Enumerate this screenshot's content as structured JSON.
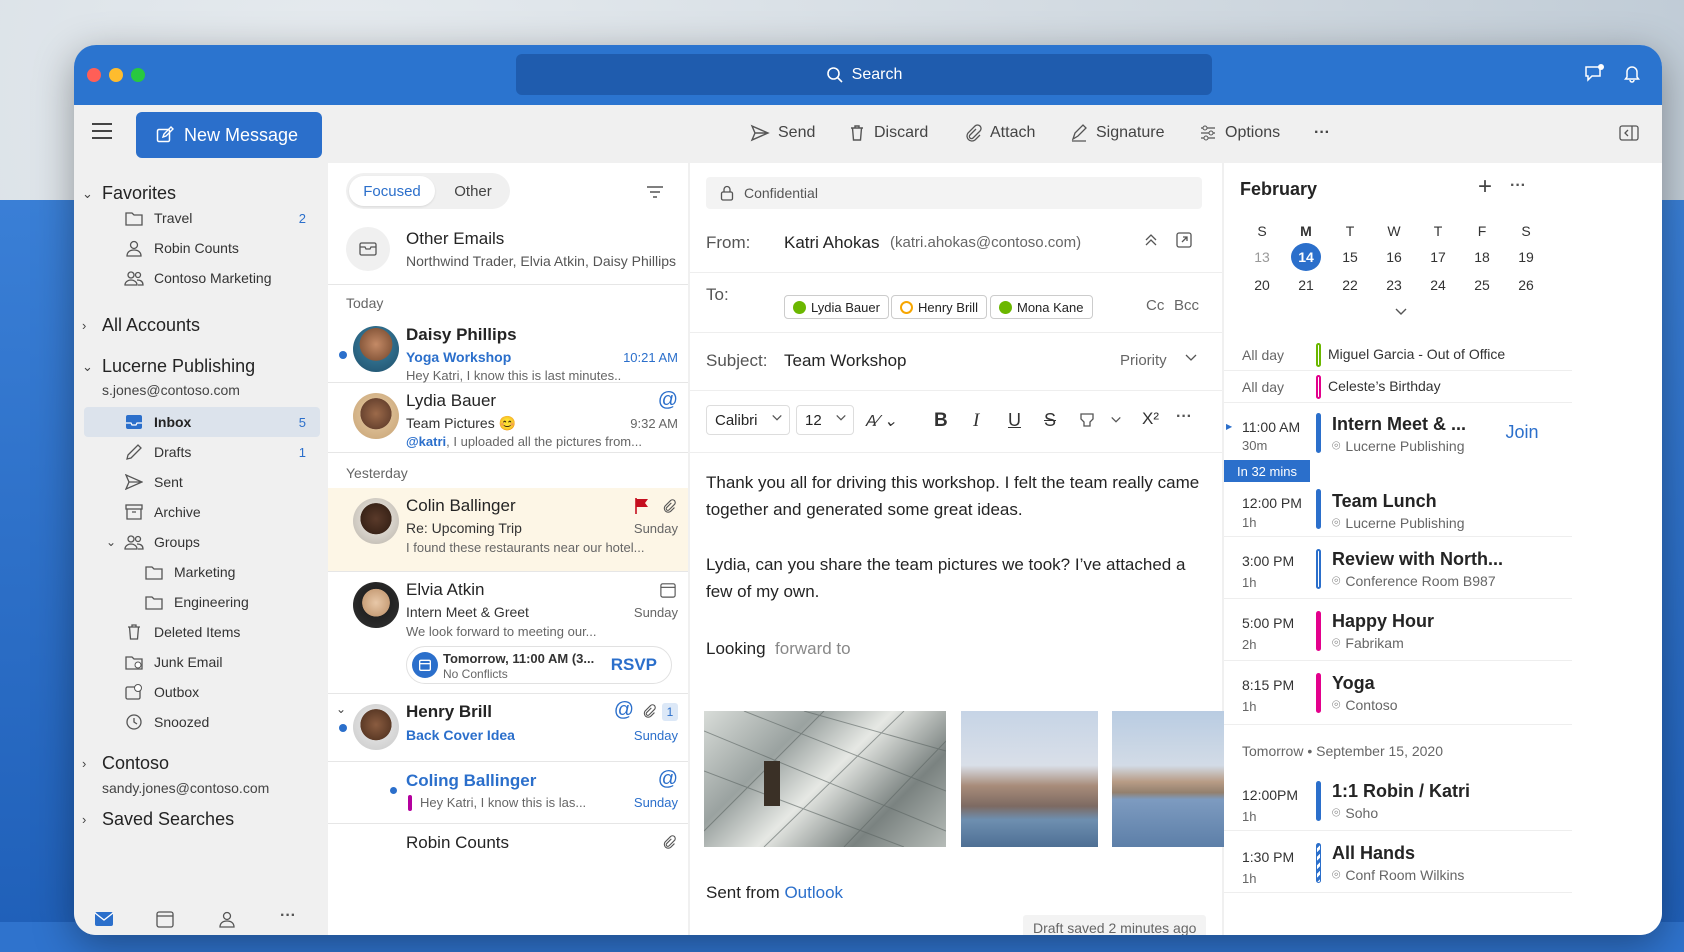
{
  "titlebar": {
    "search": "Search"
  },
  "toolbar": {
    "new_message": "New Message",
    "send": "Send",
    "discard": "Discard",
    "attach": "Attach",
    "signature": "Signature",
    "options": "Options",
    "more": "···"
  },
  "sidebar": {
    "favorites": "Favorites",
    "fav_items": [
      {
        "label": "Travel",
        "count": "2"
      },
      {
        "label": "Robin Counts",
        "count": ""
      },
      {
        "label": "Contoso Marketing",
        "count": ""
      }
    ],
    "all_accounts": "All Accounts",
    "lucerne": "Lucerne Publishing",
    "lucerne_email": "s.jones@contoso.com",
    "folders": [
      {
        "label": "Inbox",
        "count": "5"
      },
      {
        "label": "Drafts",
        "count": "1"
      },
      {
        "label": "Sent",
        "count": ""
      },
      {
        "label": "Archive",
        "count": ""
      },
      {
        "label": "Groups",
        "count": ""
      },
      {
        "label": "Marketing",
        "count": ""
      },
      {
        "label": "Engineering",
        "count": ""
      },
      {
        "label": "Deleted Items",
        "count": ""
      },
      {
        "label": "Junk Email",
        "count": ""
      },
      {
        "label": "Outbox",
        "count": ""
      },
      {
        "label": "Snoozed",
        "count": ""
      }
    ],
    "contoso": "Contoso",
    "contoso_email": "sandy.jones@contoso.com",
    "saved_searches": "Saved Searches"
  },
  "maillist": {
    "tab_focused": "Focused",
    "tab_other": "Other",
    "other_emails_title": "Other Emails",
    "other_emails_from": "Northwind Trader, Elvia Atkin, Daisy Phillips",
    "today": "Today",
    "yesterday": "Yesterday",
    "messages": [
      {
        "name": "Daisy Phillips",
        "subject": "Yoga Workshop",
        "time": "10:21 AM",
        "preview": "Hey Katri, I know this is last minutes.."
      },
      {
        "name": "Lydia Bauer",
        "subject": "Team Pictures 😊",
        "time": "9:32 AM",
        "mention": "@katri",
        "preview": ", I uploaded all the pictures from..."
      },
      {
        "name": "Colin Ballinger",
        "subject": "Re: Upcoming Trip",
        "time": "Sunday",
        "preview": "I found these restaurants near our hotel..."
      },
      {
        "name": "Elvia Atkin",
        "subject": "Intern Meet & Greet",
        "time": "Sunday",
        "preview": "We look forward to meeting our...",
        "rsvp_time": "Tomorrow, 11:00 AM (3...",
        "rsvp_status": "No Conflicts",
        "rsvp": "RSVP"
      },
      {
        "name": "Henry Brill",
        "subject": "Back Cover Idea",
        "time": "Sunday",
        "count": "1"
      },
      {
        "name": "Coling Ballinger",
        "subject": "",
        "time": "Sunday",
        "preview": "Hey Katri, I know this is las..."
      },
      {
        "name": "Robin Counts",
        "subject": "",
        "time": "",
        "preview": ""
      }
    ]
  },
  "compose": {
    "confidential": "Confidential",
    "from_label": "From:",
    "from_name": "Katri Ahokas",
    "from_email": "(katri.ahokas@contoso.com)",
    "to_label": "To:",
    "recipients": [
      "Lydia Bauer",
      "Henry Brill",
      "Mona Kane"
    ],
    "cc": "Cc",
    "bcc": "Bcc",
    "subject_label": "Subject:",
    "subject": "Team Workshop",
    "priority": "Priority",
    "font": "Calibri",
    "size": "12",
    "body1": "Thank you all for driving this workshop. I felt the team really came together and generated some great ideas.",
    "body2": "Lydia, can you share the team pictures we took? I’ve attached a few of my own.",
    "looking": "Looking",
    "forward_to": "forward to",
    "sent_from": "Sent from",
    "outlook": "Outlook",
    "draft_saved": "Draft saved 2 minutes ago"
  },
  "calendar": {
    "month": "February",
    "days": [
      "S",
      "M",
      "T",
      "W",
      "T",
      "F",
      "S"
    ],
    "week1": [
      "13",
      "14",
      "15",
      "16",
      "17",
      "18",
      "19"
    ],
    "week2": [
      "20",
      "21",
      "22",
      "23",
      "24",
      "25",
      "26"
    ],
    "allday": [
      {
        "label": "All day",
        "title": "Miguel Garcia - Out of Office",
        "color": "#6bb700"
      },
      {
        "label": "All day",
        "title": "Celeste’s Birthday",
        "color": "#e3008c"
      }
    ],
    "in_32": "In 32 mins",
    "join": "Join",
    "tomorrow": "Tomorrow • September 15, 2020",
    "events": [
      {
        "time": "11:00 AM",
        "dur": "30m",
        "title": "Intern Meet & ...",
        "loc": "Lucerne Publishing",
        "color": "#2b6fcb"
      },
      {
        "time": "12:00 PM",
        "dur": "1h",
        "title": "Team Lunch",
        "loc": "Lucerne Publishing",
        "color": "#2b6fcb"
      },
      {
        "time": "3:00 PM",
        "dur": "1h",
        "title": "Review with North...",
        "loc": "Conference Room B987",
        "color": "#2b6fcb"
      },
      {
        "time": "5:00 PM",
        "dur": "2h",
        "title": "Happy Hour",
        "loc": "Fabrikam",
        "color": "#e3008c"
      },
      {
        "time": "8:15 PM",
        "dur": "1h",
        "title": "Yoga",
        "loc": "Contoso",
        "color": "#e3008c"
      },
      {
        "time": "12:00PM",
        "dur": "1h",
        "title": "1:1 Robin / Katri",
        "loc": "Soho",
        "color": "#2b6fcb"
      },
      {
        "time": "1:30 PM",
        "dur": "1h",
        "title": "All Hands",
        "loc": "Conf Room Wilkins",
        "color": "#2b6fcb"
      }
    ]
  }
}
